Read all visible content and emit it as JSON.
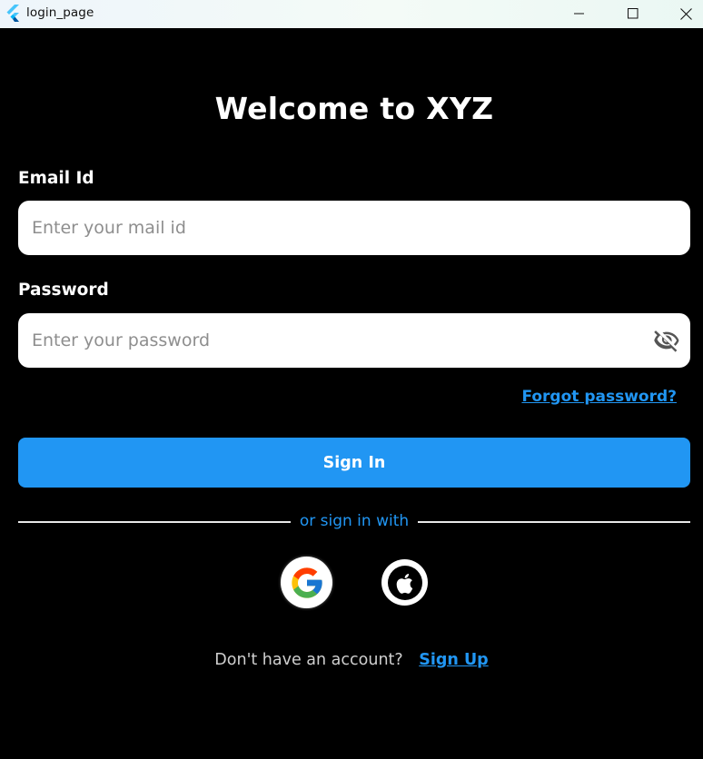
{
  "window": {
    "title": "login_page"
  },
  "page": {
    "heading": "Welcome to XYZ",
    "email": {
      "label": "Email Id",
      "placeholder": "Enter your mail id",
      "value": ""
    },
    "password": {
      "label": "Password",
      "placeholder": "Enter your password",
      "value": "",
      "visibility_icon": "eye-off-icon"
    },
    "forgot_password_link": "Forgot password?",
    "sign_in_button": "Sign In",
    "divider_text": "or sign in with",
    "social": [
      {
        "name": "google",
        "icon": "google-icon"
      },
      {
        "name": "apple",
        "icon": "apple-icon"
      }
    ],
    "signup": {
      "prompt": "Don't have an account?",
      "link": "Sign Up"
    }
  },
  "colors": {
    "background": "#000000",
    "accent": "#2196f3",
    "input_background": "#ffffff",
    "placeholder": "#8e8e8e"
  }
}
